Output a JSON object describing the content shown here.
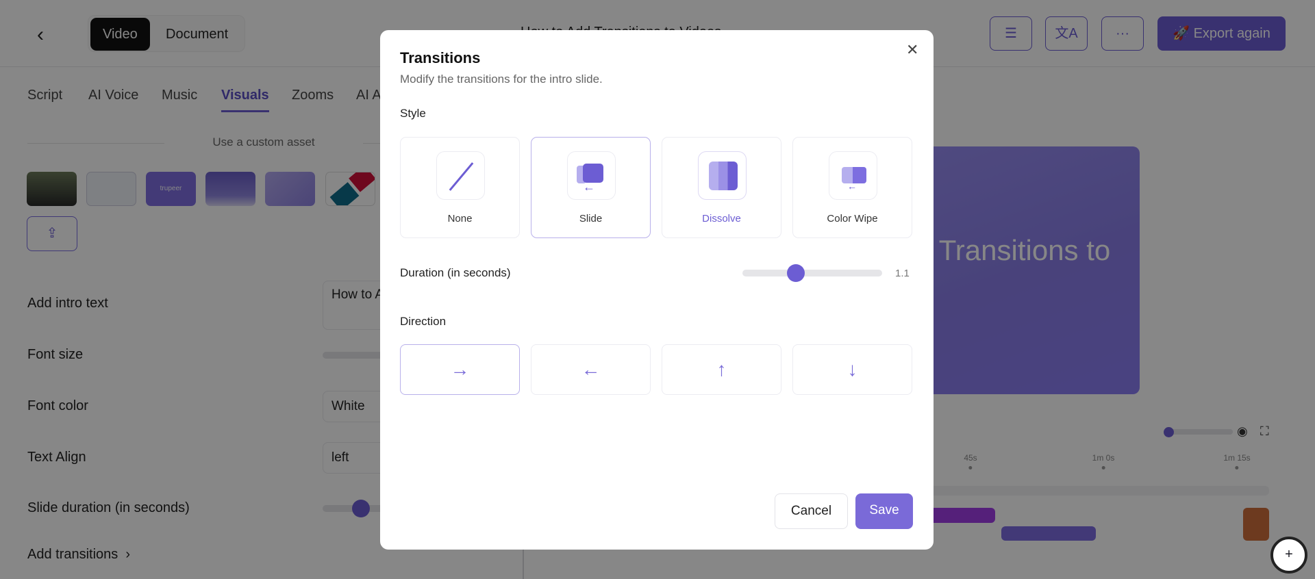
{
  "header": {
    "title": "How to Add Transitions to Videos",
    "mode_video": "Video",
    "mode_document": "Document",
    "export_label": "Export again"
  },
  "tabs": [
    "Script",
    "AI Voice",
    "Music",
    "Visuals",
    "Zooms",
    "AI Avatar"
  ],
  "assets": {
    "heading": "Use a custom asset",
    "trupeer_label": "trupeer"
  },
  "form": {
    "intro_label": "Add intro text",
    "intro_value": "How to Add Transitions to Videos",
    "font_size_label": "Font size",
    "font_color_label": "Font color",
    "font_color_value": "White",
    "align_label": "Text Align",
    "align_value": "left",
    "slide_duration_label": "Slide duration (in seconds)",
    "transitions_label": "Add transitions"
  },
  "preview": {
    "text": "How to Add Transitions to Videos"
  },
  "timeline": {
    "ticks": [
      "45s",
      "1m 0s",
      "1m 15s"
    ]
  },
  "modal": {
    "title": "Transitions",
    "subtitle": "Modify the transitions for the intro slide.",
    "style_label": "Style",
    "styles": [
      "None",
      "Slide",
      "Dissolve",
      "Color Wipe"
    ],
    "selected_style": "Slide",
    "duration_label": "Duration (in seconds)",
    "duration_value": "1.1",
    "duration_fraction": 0.38,
    "direction_label": "Direction",
    "directions": [
      "→",
      "←",
      "↑",
      "↓"
    ],
    "selected_direction": "→",
    "cancel": "Cancel",
    "save": "Save"
  },
  "colors": {
    "accent": "#6c5dd3"
  }
}
